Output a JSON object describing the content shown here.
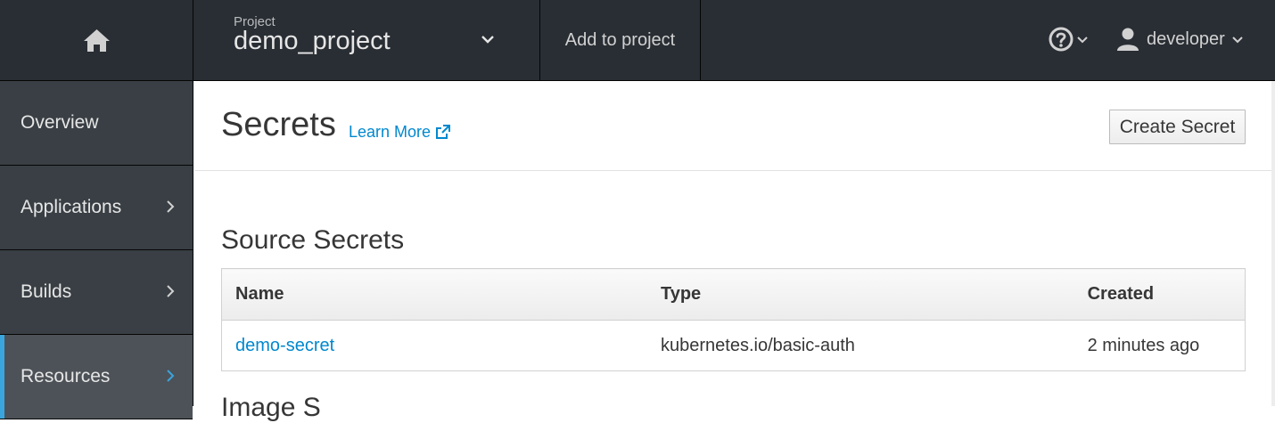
{
  "topbar": {
    "project_kicker": "Project",
    "project_name": "demo_project",
    "add_to_project": "Add to project",
    "user_name": "developer"
  },
  "sidebar": {
    "items": [
      {
        "label": "Overview"
      },
      {
        "label": "Applications"
      },
      {
        "label": "Builds"
      },
      {
        "label": "Resources"
      }
    ]
  },
  "main": {
    "title": "Secrets",
    "learn_more": "Learn More",
    "create_button": "Create Secret",
    "section_title": "Source Secrets",
    "table": {
      "headers": [
        "Name",
        "Type",
        "Created"
      ],
      "rows": [
        {
          "name": "demo-secret",
          "type": "kubernetes.io/basic-auth",
          "created": "2 minutes ago"
        }
      ]
    },
    "next_section_peek": "Image S"
  },
  "colors": {
    "topbar_bg": "#292e34",
    "sidebar_bg": "#393f44",
    "active_accent": "#39a5dc",
    "link": "#0088ce"
  },
  "icons": [
    "home-icon",
    "chevron-down-icon",
    "help-icon",
    "user-icon",
    "chevron-right-icon",
    "external-link-icon"
  ]
}
